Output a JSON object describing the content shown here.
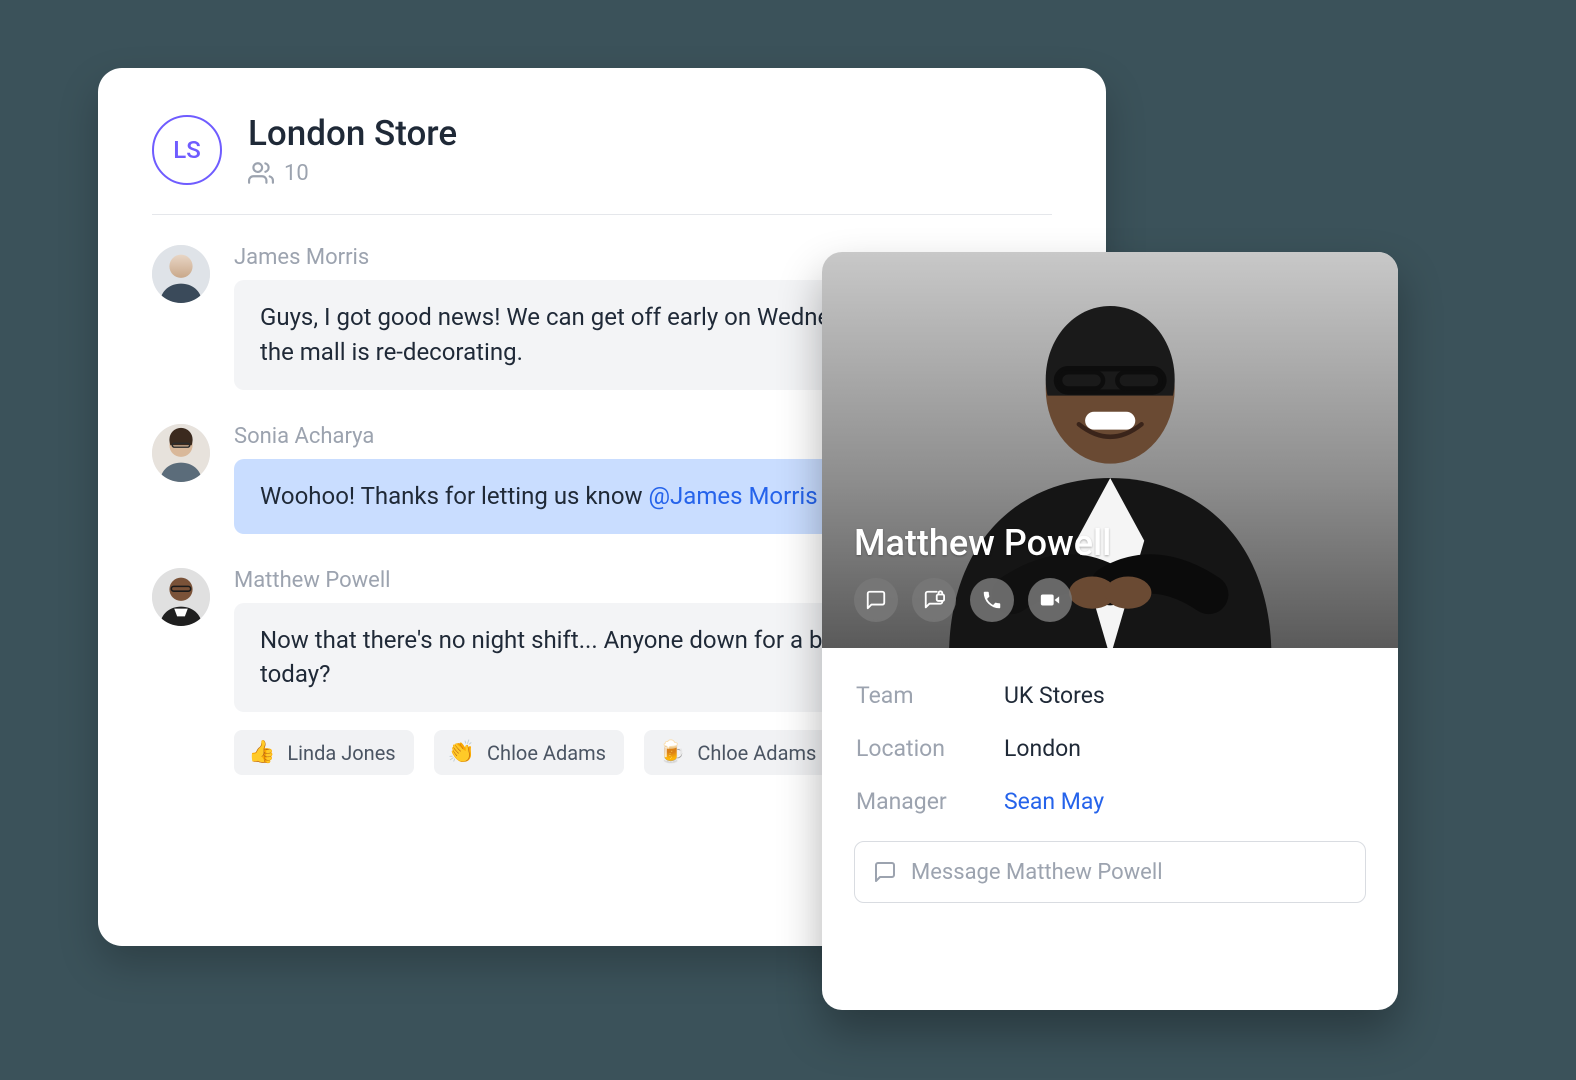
{
  "chat": {
    "avatar_initials": "LS",
    "title": "London Store",
    "member_count": "10",
    "messages": [
      {
        "author": "James Morris",
        "text": "Guys, I got good news! We can get off early on Wednesday because the mall is re-decorating.",
        "highlighted": false
      },
      {
        "author": "Sonia Acharya",
        "prefix": "Woohoo! Thanks for letting us know ",
        "mention": "@James Morris",
        "highlighted": true
      },
      {
        "author": "Matthew Powell",
        "text": "Now that there's no night shift... Anyone down for a beer after work today?",
        "highlighted": false,
        "reactions": [
          {
            "emoji": "👍",
            "name": "Linda Jones"
          },
          {
            "emoji": "👏",
            "name": "Chloe Adams"
          },
          {
            "emoji": "🍺",
            "name": "Chloe Adams"
          }
        ]
      }
    ]
  },
  "profile": {
    "name": "Matthew Powell",
    "details": {
      "team_label": "Team",
      "team_value": "UK Stores",
      "location_label": "Location",
      "location_value": "London",
      "manager_label": "Manager",
      "manager_value": "Sean May"
    },
    "message_placeholder": "Message Matthew Powell"
  }
}
